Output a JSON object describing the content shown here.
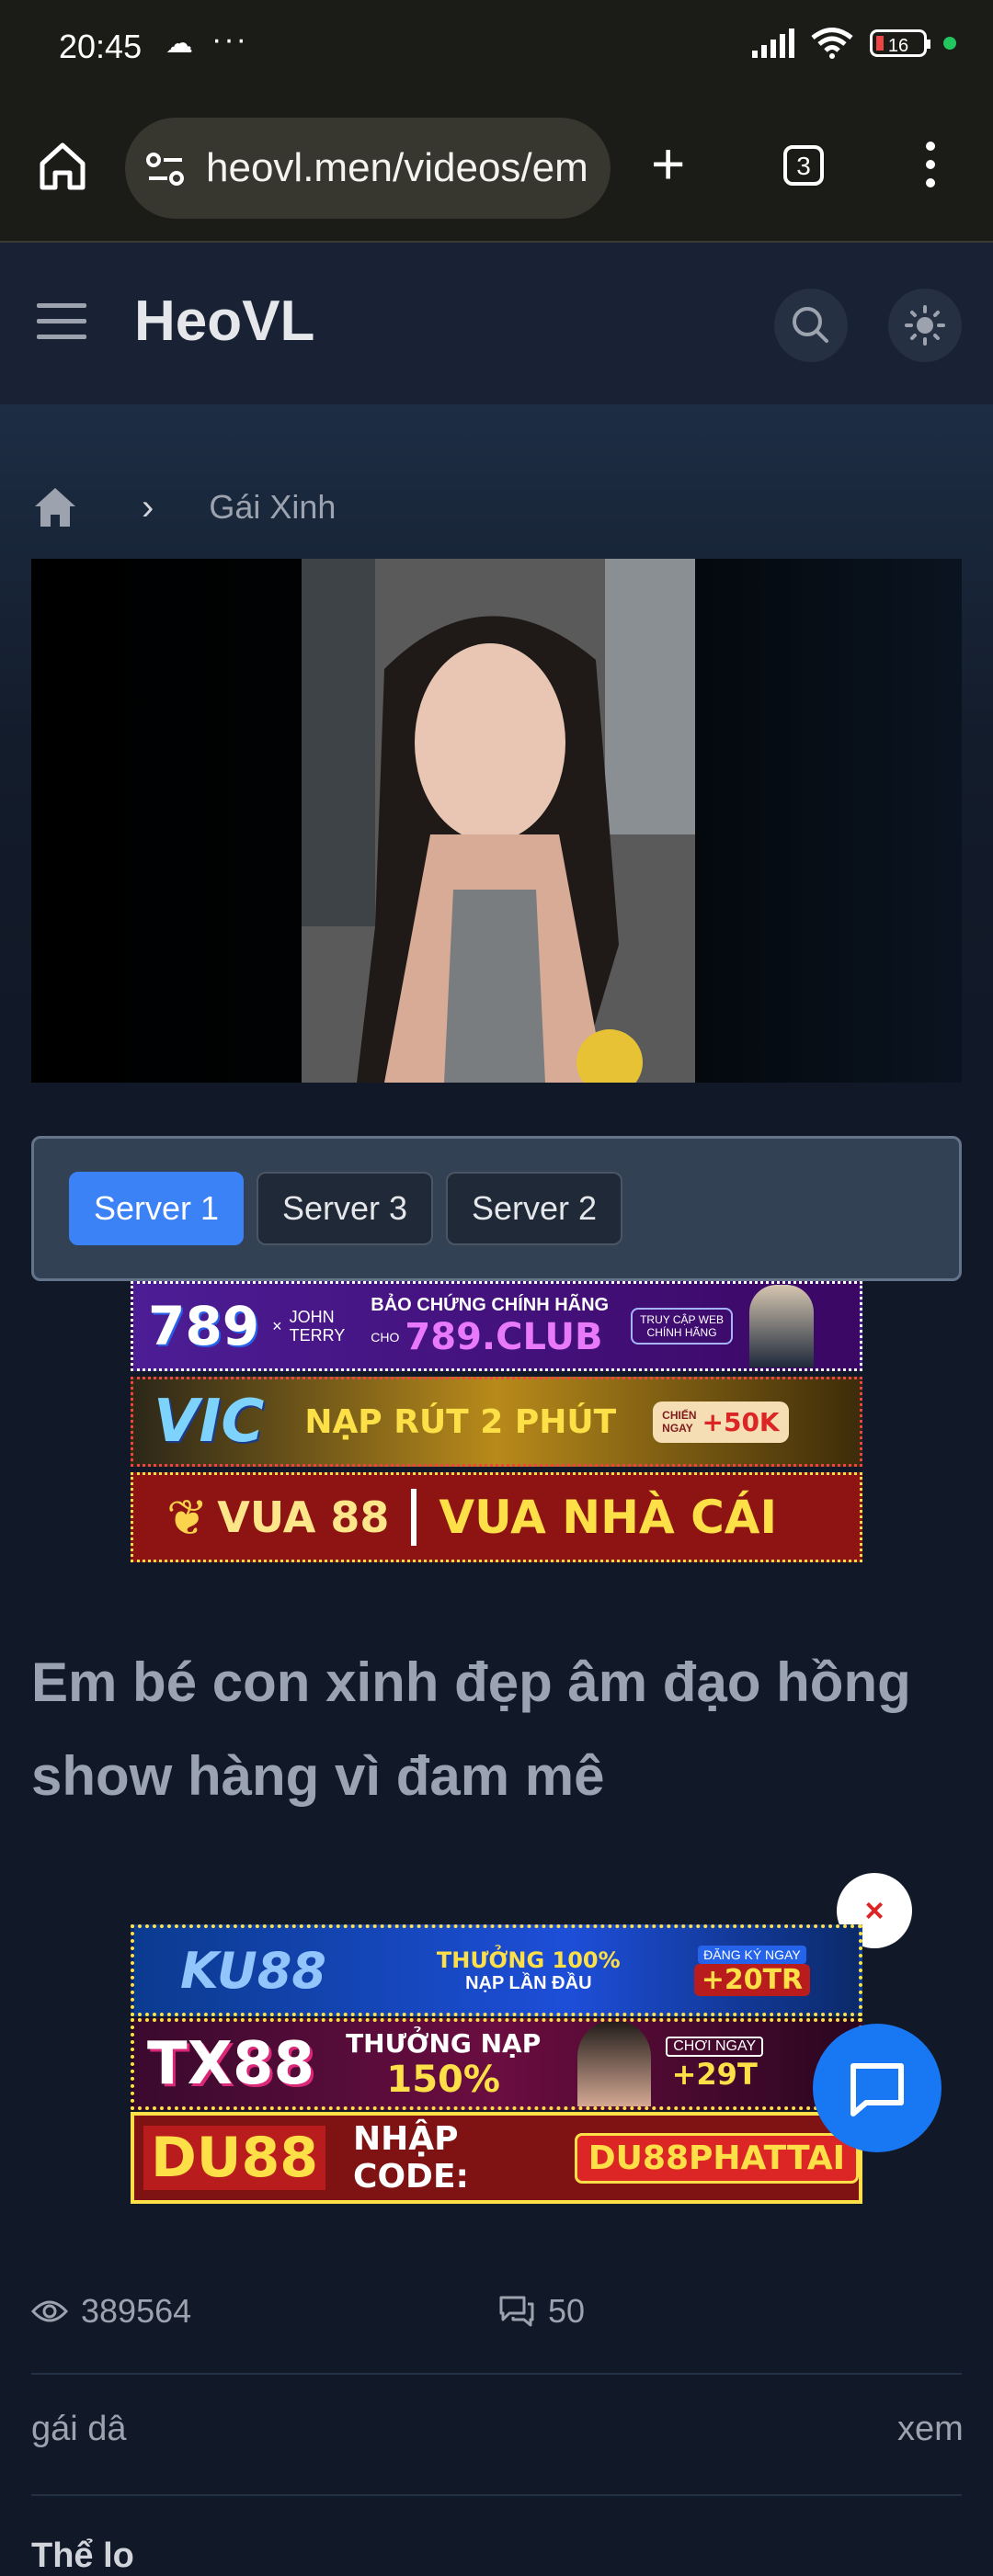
{
  "status_bar": {
    "time": "20:45",
    "dots": "···",
    "battery": "16"
  },
  "browser": {
    "url": "heovl.men/videos/em",
    "tabs_count": "3"
  },
  "header": {
    "logo": "HeoVL"
  },
  "breadcrumb": {
    "category": "Gái Xinh"
  },
  "servers": [
    "Server 1",
    "Server 3",
    "Server 2"
  ],
  "ads_top": [
    {
      "brand": "789",
      "sub1": "JOHN",
      "sub2": "TERRY",
      "slogan": "BẢO CHỨNG CHÍNH HÃNG",
      "cho": "CHO",
      "domain": "789.CLUB",
      "cta1": "TRUY CẬP WEB",
      "cta2": "CHÍNH HÃNG"
    },
    {
      "brand": "VIC",
      "slogan": "NẠP RÚT 2 PHÚT",
      "cta1": "CHIẾN",
      "cta2": "NGAY",
      "bonus": "+50K"
    },
    {
      "brand": "VUA 88",
      "slogan": "VUA NHÀ CÁI"
    }
  ],
  "video": {
    "title": "Em bé con xinh đẹp âm đạo hồng show hàng vì đam mê",
    "views": "389564",
    "comments": "50"
  },
  "tags_left": "gái dâ",
  "tags_right": "xem",
  "section_label": "Thể lo",
  "ads_bottom": [
    {
      "brand": "KU88",
      "slogan1": "THƯỞNG 100%",
      "slogan2": "NẠP LẦN ĐẦU",
      "cta1": "ĐĂNG KÝ NGAY",
      "bonus": "+20TR"
    },
    {
      "brand": "TX88",
      "slogan1": "THƯỞNG NẠP",
      "slogan2": "150%",
      "cta1": "CHƠI NGAY",
      "bonus": "+29T"
    },
    {
      "brand": "DU88",
      "slogan1": "NHẬP CODE:",
      "code": "DU88PHATTAI"
    }
  ],
  "close_symbol": "×"
}
